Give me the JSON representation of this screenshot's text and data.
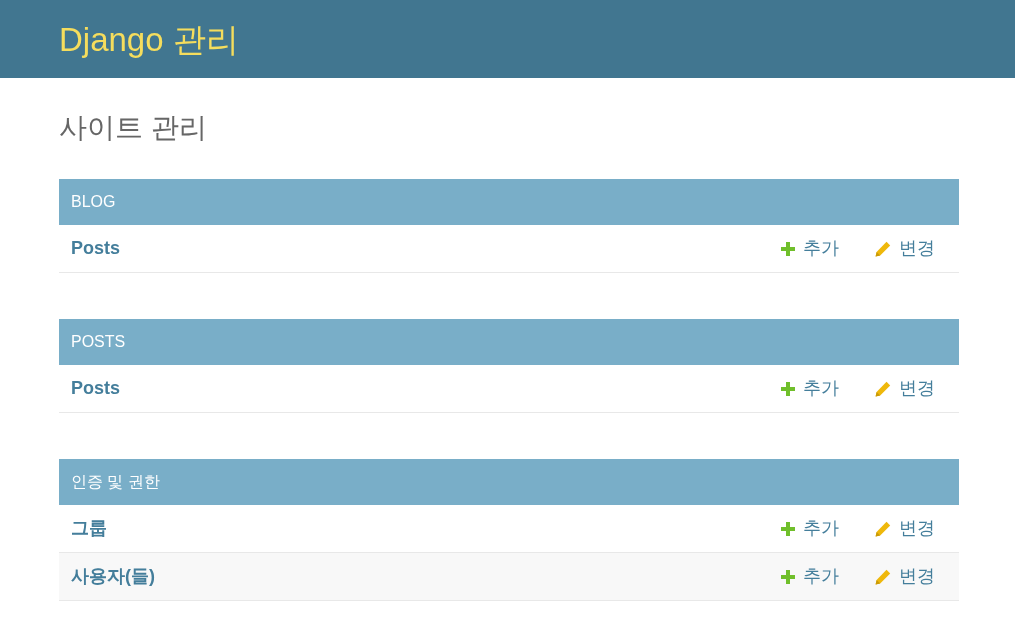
{
  "header": {
    "title": "Django 관리"
  },
  "page_title": "사이트 관리",
  "modules": [
    {
      "caption": "BLOG",
      "models": [
        {
          "name": "Posts",
          "add": "추가",
          "change": "변경"
        }
      ]
    },
    {
      "caption": "POSTS",
      "models": [
        {
          "name": "Posts",
          "add": "추가",
          "change": "변경"
        }
      ]
    },
    {
      "caption": "인증 및 권한",
      "models": [
        {
          "name": "그룹",
          "add": "추가",
          "change": "변경"
        },
        {
          "name": "사용자(들)",
          "add": "추가",
          "change": "변경"
        }
      ]
    }
  ]
}
